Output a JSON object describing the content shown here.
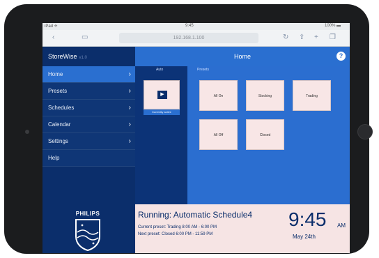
{
  "browser": {
    "status_left": "iPad ✈",
    "status_center": "9:45",
    "status_right": "100% ▬",
    "url": "192.168.1.100",
    "back_icon": "back-arrow-icon",
    "book_icon": "bookmarks-icon"
  },
  "sidebar": {
    "brand": "StoreWise",
    "brand_sub": "v1.0",
    "items": [
      {
        "label": "Home",
        "active": true
      },
      {
        "label": "Presets"
      },
      {
        "label": "Schedules"
      },
      {
        "label": "Calendar"
      },
      {
        "label": "Settings"
      },
      {
        "label": "Help"
      }
    ],
    "logo": "PHILIPS"
  },
  "header": {
    "title": "Home",
    "help": "?"
  },
  "columns": {
    "play_label": "Auto",
    "presets_label": "Presets"
  },
  "play": {
    "caption": "Currently active",
    "icon": "play-icon"
  },
  "presets": [
    {
      "label": "All On"
    },
    {
      "label": "Stocking"
    },
    {
      "label": "Trading"
    },
    {
      "label": "All Off"
    },
    {
      "label": "Closed"
    }
  ],
  "status": {
    "running": "Running: Automatic Schedule4",
    "current": "Current preset: Trading    8:00 AM - 6:00 PM",
    "next": "Next preset: Closed        6:00 PM - 11:59 PM",
    "time": "9:45",
    "ampm": "AM",
    "date": "May 24th"
  }
}
